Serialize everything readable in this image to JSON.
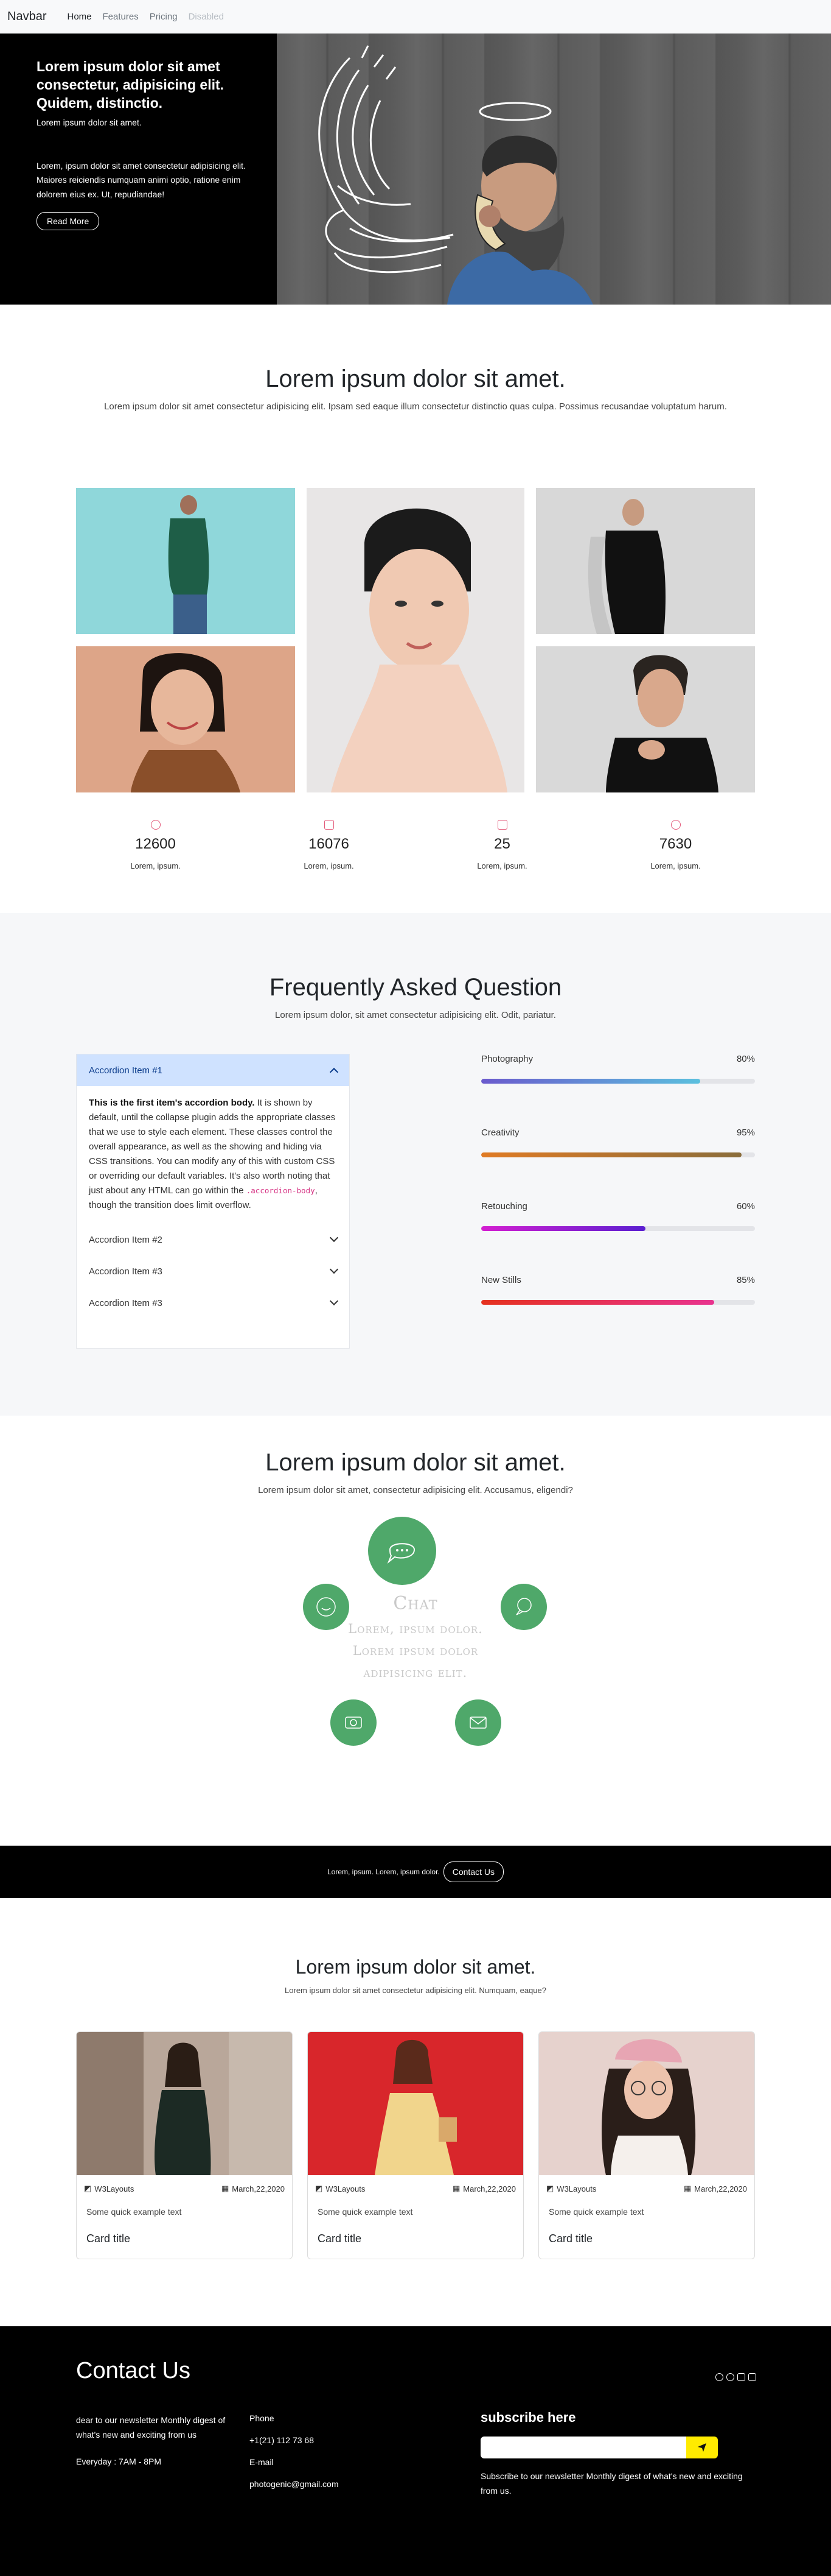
{
  "nav": {
    "brand": "Navbar",
    "links": [
      "Home",
      "Features",
      "Pricing",
      "Disabled"
    ]
  },
  "hero": {
    "title": "Lorem ipsum dolor sit amet consectetur, adipisicing elit. Quidem, distinctio.",
    "subtitle": "Lorem ipsum dolor sit amet.",
    "text": "Lorem, ipsum dolor sit amet consectetur adipisicing elit. Maiores reiciendis numquam animi optio, ratione enim dolorem eius ex. Ut, repudiandae!",
    "button": "Read More"
  },
  "gallery": {
    "title": "Lorem ipsum dolor sit amet.",
    "subtitle": "Lorem ipsum dolor sit amet consectetur adipisicing elit. Ipsam sed eaque illum consectetur distinctio quas culpa. Possimus recusandae voluptatum harum.",
    "stats": [
      {
        "value": "12600",
        "label": "Lorem, ipsum.",
        "icon": "emoji-smile-icon"
      },
      {
        "value": "16076",
        "label": "Lorem, ipsum.",
        "icon": "image-icon"
      },
      {
        "value": "25",
        "label": "Lorem, ipsum.",
        "icon": "camera-reels-icon"
      },
      {
        "value": "7630",
        "label": "Lorem, ipsum.",
        "icon": "trophy-icon"
      }
    ]
  },
  "faq": {
    "title": "Frequently Asked Question",
    "subtitle": "Lorem ipsum dolor, sit amet consectetur adipisicing elit. Odit, pariatur.",
    "items": [
      {
        "title": "Accordion Item #1",
        "open": true
      },
      {
        "title": "Accordion Item #2",
        "open": false
      },
      {
        "title": "Accordion Item #3",
        "open": false
      },
      {
        "title": "Accordion Item #3",
        "open": false
      }
    ],
    "body_bold": "This is the first item's accordion body.",
    "body_text": " It is shown by default, until the collapse plugin adds the appropriate classes that we use to style each element. These classes control the overall appearance, as well as the showing and hiding via CSS transitions. You can modify any of this with custom CSS or overriding our default variables. It's also worth noting that just about any HTML can go within the ",
    "body_code": ".accordion-body",
    "body_end": ", though the transition does limit overflow.",
    "skills": [
      {
        "name": "Photography",
        "percent": "80%",
        "value": 80,
        "colors": [
          "#6a5acd",
          "#5bc0de"
        ]
      },
      {
        "name": "Creativity",
        "percent": "95%",
        "value": 95,
        "colors": [
          "#e07b24",
          "#8a6d3b"
        ]
      },
      {
        "name": "Retouching",
        "percent": "60%",
        "value": 60,
        "colors": [
          "#d41fd1",
          "#5a1fd1"
        ]
      },
      {
        "name": "New Stills",
        "percent": "85%",
        "value": 85,
        "colors": [
          "#e5321f",
          "#e8338f"
        ]
      }
    ]
  },
  "services": {
    "title": "Lorem ipsum dolor sit amet.",
    "subtitle": "Lorem ipsum dolor sit amet, consectetur adipisicing elit. Accusamus, eligendi?",
    "center_title": "Chat",
    "center_desc": [
      "Lorem, ipsum dolor.",
      "Lorem ipsum dolor",
      "adipisicing elit."
    ],
    "color": "#4fa86a"
  },
  "cta": {
    "text": "Lorem, ipsum. Lorem, ipsum dolor.",
    "button": "Contact Us"
  },
  "cards": {
    "title": "Lorem ipsum dolor sit amet.",
    "subtitle": "Lorem ipsum dolor sit amet consectetur adipisicing elit. Numquam, eaque?",
    "items": [
      {
        "author": "W3Layouts",
        "date": "March,22,2020",
        "text": "Some quick example text",
        "title": "Card title"
      },
      {
        "author": "W3Layouts",
        "date": "March,22,2020",
        "text": "Some quick example text",
        "title": "Card title"
      },
      {
        "author": "W3Layouts",
        "date": "March,22,2020",
        "text": "Some quick example text",
        "title": "Card title"
      }
    ]
  },
  "footer": {
    "title": "Contact Us",
    "newsletter_text": "dear to our newsletter Monthly digest of what's new and exciting from us",
    "hours": "Everyday : 7AM - 8PM",
    "phone_label": "Phone",
    "phone": "+1(21) 112 73 68",
    "email_label": "E-mail",
    "email": "photogenic@gmail.com",
    "subscribe_title": "subscribe here",
    "subscribe_note": "Subscribe to our newsletter Monthly digest of what's new and exciting from us.",
    "social": [
      "facebook-icon",
      "twitter-icon",
      "instagram-icon",
      "linkedin-icon"
    ]
  }
}
